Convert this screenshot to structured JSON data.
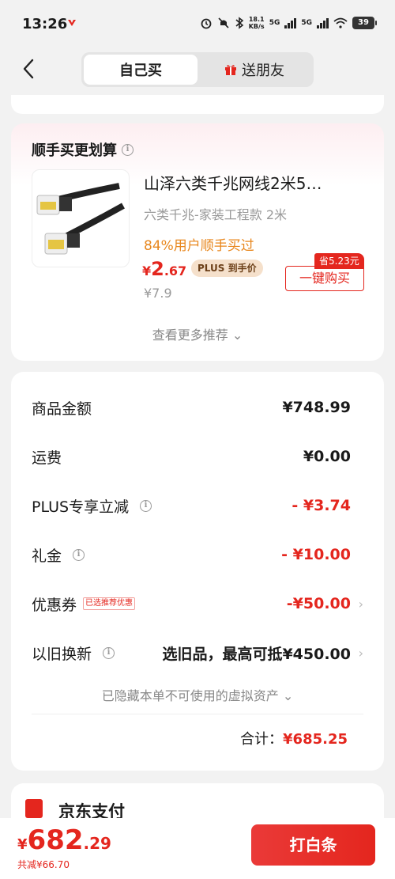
{
  "status_bar": {
    "time": "13:26",
    "net_speed": "18.1",
    "net_unit": "KB/s",
    "sig1": "5G",
    "sig2": "5G",
    "battery": "39"
  },
  "header": {
    "tabs": [
      {
        "label": "自己买"
      },
      {
        "label": "送朋友"
      }
    ]
  },
  "recommend": {
    "title": "顺手买更划算",
    "product": {
      "name": "山泽六类千兆网线2米5…",
      "spec": "六类千兆-家装工程款   2米",
      "buy_info": "84%用户顺手买过",
      "price_cur": "¥",
      "price_int": "2",
      "price_dec": ".67",
      "plus_tag": "PLUS 到手价",
      "old_price": "¥7.9",
      "save_tag": "省5.23元",
      "buy_button": "一键购买"
    },
    "more": "查看更多推荐 ⌄"
  },
  "summary": {
    "rows": [
      {
        "label": "商品金额",
        "value": "¥748.99"
      },
      {
        "label": "运费",
        "value": "¥0.00"
      },
      {
        "label": "PLUS专享立减",
        "value": "- ¥3.74"
      },
      {
        "label": "礼金",
        "value": "- ¥10.00"
      },
      {
        "label": "优惠券",
        "tag": "已选推荐优惠",
        "value": "-¥50.00"
      },
      {
        "label": "以旧换新",
        "value": "选旧品，最高可抵¥450.00"
      }
    ],
    "hidden_assets": "已隐藏本单不可使用的虚拟资产 ⌄",
    "total_label": "合计：",
    "total_value": "¥685.25"
  },
  "payment": {
    "title": "京东支付"
  },
  "bottom_bar": {
    "price_cur": "¥",
    "price_int": "682",
    "price_dec": ".29",
    "saved": "共减¥66.70",
    "pay_button": "打白条"
  },
  "colors": {
    "accent_red": "#e4261e",
    "orange": "#e8871e"
  }
}
